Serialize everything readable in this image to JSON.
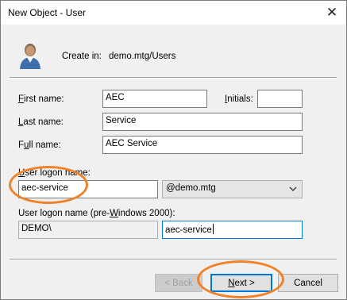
{
  "dialog": {
    "title": "New Object - User",
    "close_glyph": "✕",
    "create_in_label": "Create in:",
    "create_in_path": "demo.mtg/Users",
    "avatar_icon": "user-avatar-icon"
  },
  "form": {
    "first_name_label": "First name:",
    "first_name_value": "AEC",
    "initials_label": "Initials:",
    "initials_value": "",
    "last_name_label": "Last name:",
    "last_name_value": "Service",
    "full_name_label": "Full name:",
    "full_name_value": "AEC Service",
    "logon_name_label": "User logon name:",
    "logon_name_value": "aec-service",
    "domain_selected": "@demo.mtg",
    "pre2000_label": "User logon name (pre-Windows 2000):",
    "pre2000_domain": "DEMO\\",
    "pre2000_name": "aec-service"
  },
  "buttons": {
    "back": "< Back",
    "next": "Next >",
    "cancel": "Cancel"
  },
  "colors": {
    "highlight": "#f0822a",
    "focus": "#0078d7",
    "dialog_bg": "#f0f0f0"
  }
}
